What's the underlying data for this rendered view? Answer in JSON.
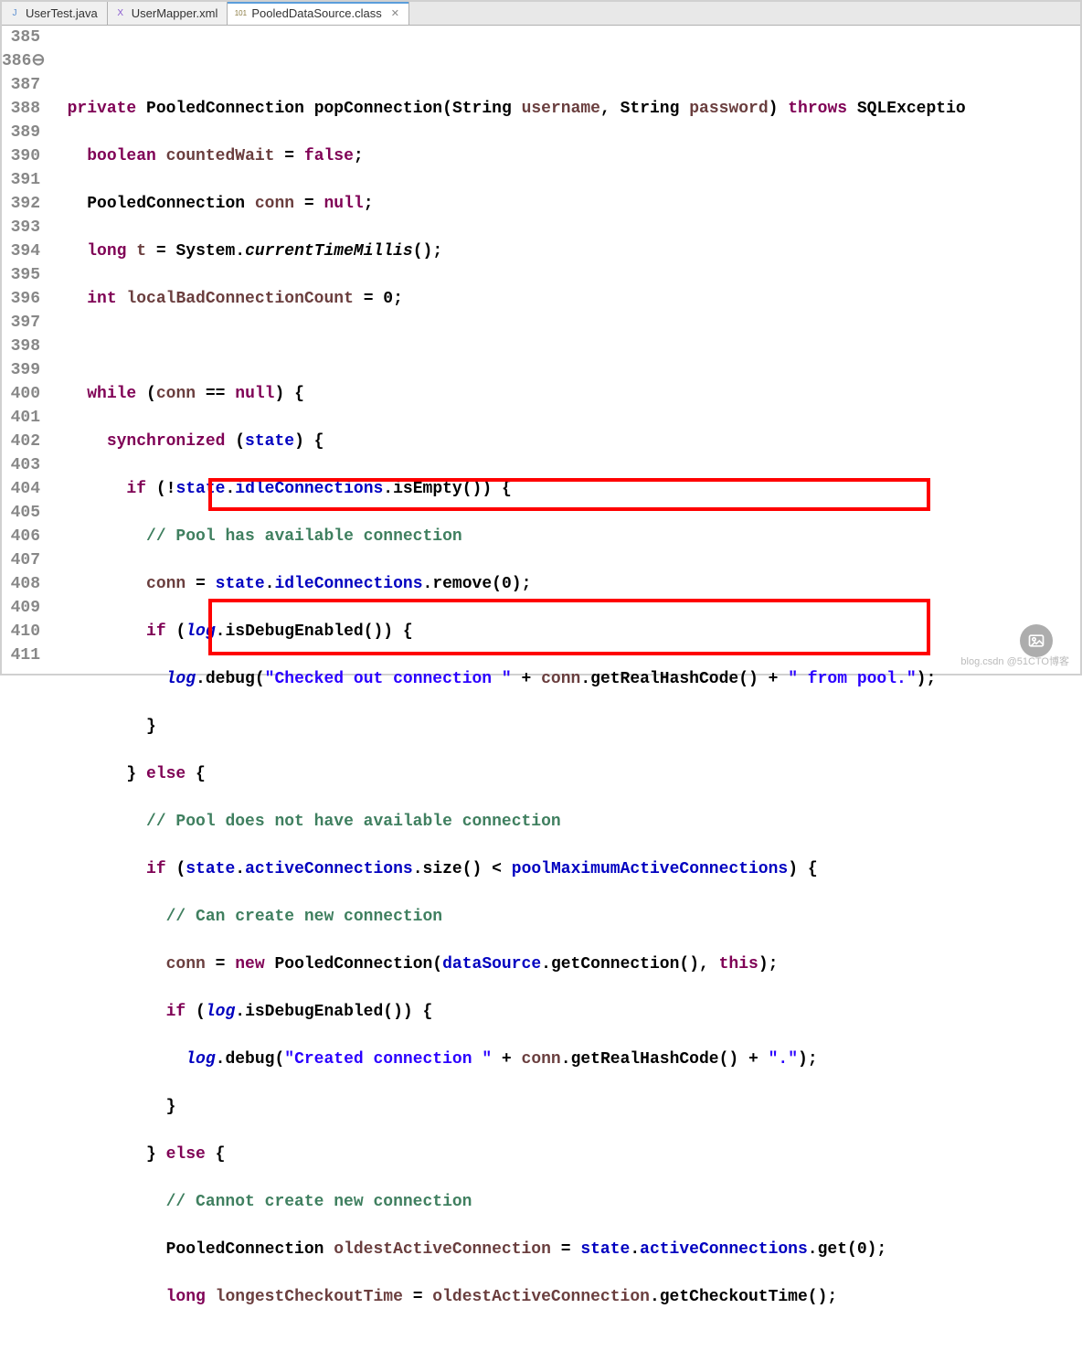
{
  "tabs": [
    {
      "label": "UserTest.java",
      "icon": "J",
      "iconColor": "#5b8fd0",
      "active": false
    },
    {
      "label": "UserMapper.xml",
      "icon": "X",
      "iconColor": "#8a5bd0",
      "active": false
    },
    {
      "label": "PooledDataSource.class",
      "icon": "101",
      "iconColor": "#8a7a40",
      "active": true
    }
  ],
  "lineStart": 385,
  "code": {
    "l385": "",
    "l386_private": "private",
    "l386_type": "PooledConnection",
    "l386_name": "popConnection",
    "l386_p1t": "String",
    "l386_p1n": "username",
    "l386_p2t": "String",
    "l386_p2n": "password",
    "l386_throws": "throws",
    "l386_ex": "SQLExceptio",
    "l387_kw": "boolean",
    "l387_var": "countedWait",
    "l387_val": "false",
    "l388_type": "PooledConnection",
    "l388_var": "conn",
    "l388_val": "null",
    "l389_kw": "long",
    "l389_var": "t",
    "l389_cls": "System",
    "l389_m": "currentTimeMillis",
    "l390_kw": "int",
    "l390_var": "localBadConnectionCount",
    "l390_val": "0",
    "l392_while": "while",
    "l392_conn": "conn",
    "l392_null": "null",
    "l393_sync": "synchronized",
    "l393_state": "state",
    "l394_if": "if",
    "l394_state": "state",
    "l394_idle": "idleConnections",
    "l394_m": "isEmpty",
    "l395_c": "// Pool has available connection",
    "l396_conn": "conn",
    "l396_state": "state",
    "l396_idle": "idleConnections",
    "l396_m": "remove",
    "l396_arg": "0",
    "l397_if": "if",
    "l397_log": "log",
    "l397_m": "isDebugEnabled",
    "l398_log": "log",
    "l398_m": "debug",
    "l398_s1": "\"Checked out connection \"",
    "l398_conn": "conn",
    "l398_m2": "getRealHashCode",
    "l398_s2": "\" from pool.\"",
    "l400_else": "else",
    "l401_c": "// Pool does not have available connection",
    "l402_if": "if",
    "l402_state": "state",
    "l402_ac": "activeConnections",
    "l402_m": "size",
    "l402_pm": "poolMaximumActiveConnections",
    "l403_c": "// Can create new connection",
    "l404_conn": "conn",
    "l404_new": "new",
    "l404_type": "PooledConnection",
    "l404_ds": "dataSource",
    "l404_m": "getConnection",
    "l404_this": "this",
    "l405_if": "if",
    "l405_log": "log",
    "l405_m": "isDebugEnabled",
    "l406_log": "log",
    "l406_m": "debug",
    "l406_s1": "\"Created connection \"",
    "l406_conn": "conn",
    "l406_m2": "getRealHashCode",
    "l406_s2": "\".\"",
    "l408_else": "else",
    "l409_c": "// Cannot create new connection",
    "l410_type": "PooledConnection",
    "l410_var": "oldestActiveConnection",
    "l410_state": "state",
    "l410_ac": "activeConnections",
    "l410_m": "get",
    "l410_arg": "0",
    "l411_kw": "long",
    "l411_var": "longestCheckoutTime",
    "l411_oac": "oldestActiveConnection",
    "l411_m": "getCheckoutTime"
  },
  "watermark": "blog.csdn @51CTO博客"
}
